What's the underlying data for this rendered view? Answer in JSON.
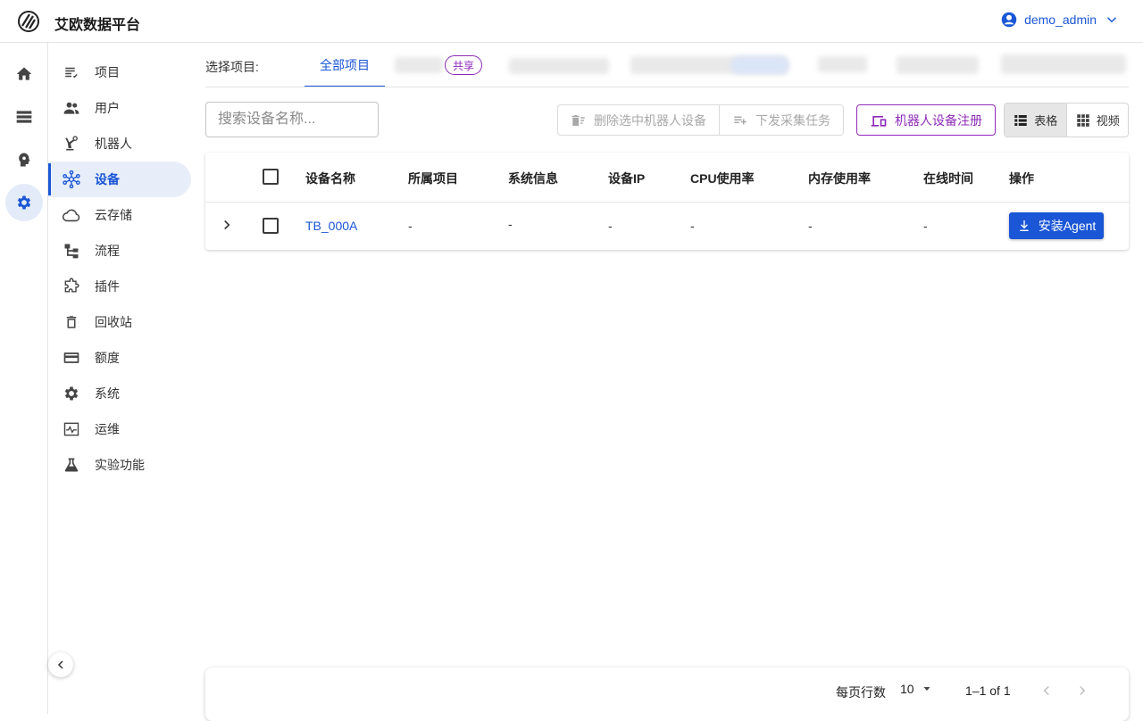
{
  "app": {
    "title": "艾欧数据平台"
  },
  "user": {
    "name": "demo_admin"
  },
  "colors": {
    "primary": "#1a56d6",
    "accent_purple": "#8e2bb8",
    "nav_active_bg": "#e8eef9"
  },
  "rail": [
    {
      "name": "home-icon",
      "active": false
    },
    {
      "name": "storage-icon",
      "active": false
    },
    {
      "name": "brain-icon",
      "active": false
    },
    {
      "name": "settings-icon",
      "active": true
    }
  ],
  "sidebar": {
    "items": [
      {
        "label": "项目",
        "icon": "project-list-icon"
      },
      {
        "label": "用户",
        "icon": "users-icon"
      },
      {
        "label": "机器人",
        "icon": "robot-arm-icon"
      },
      {
        "label": "设备",
        "icon": "device-hub-icon",
        "active": true
      },
      {
        "label": "云存储",
        "icon": "cloud-icon"
      },
      {
        "label": "流程",
        "icon": "flow-icon"
      },
      {
        "label": "插件",
        "icon": "plugin-icon"
      },
      {
        "label": "回收站",
        "icon": "trash-icon"
      },
      {
        "label": "额度",
        "icon": "credit-card-icon"
      },
      {
        "label": "系统",
        "icon": "gear-icon"
      },
      {
        "label": "运维",
        "icon": "monitor-icon"
      },
      {
        "label": "实验功能",
        "icon": "flask-icon"
      }
    ]
  },
  "projects": {
    "label": "选择项目:",
    "all_tab": "全部项目",
    "share_badge": "共享"
  },
  "toolbar": {
    "search_placeholder": "搜索设备名称...",
    "delete_label": "删除选中机器人设备",
    "dispatch_label": "下发采集任务",
    "register_label": "机器人设备注册",
    "view_table_label": "表格",
    "view_video_label": "视频"
  },
  "table": {
    "headers": [
      "设备名称",
      "所属项目",
      "系统信息",
      "设备IP",
      "CPU使用率",
      "内存使用率",
      "在线时间",
      "操作"
    ],
    "rows": [
      {
        "name": "TB_000A",
        "project": "-",
        "system": "-",
        "ip": "-",
        "cpu": "-",
        "memory": "-",
        "online": "-",
        "action": "安装Agent"
      }
    ]
  },
  "pagination": {
    "rows_per_page_label": "每页行数",
    "rows_per_page": "10",
    "range": "1–1 of 1"
  }
}
